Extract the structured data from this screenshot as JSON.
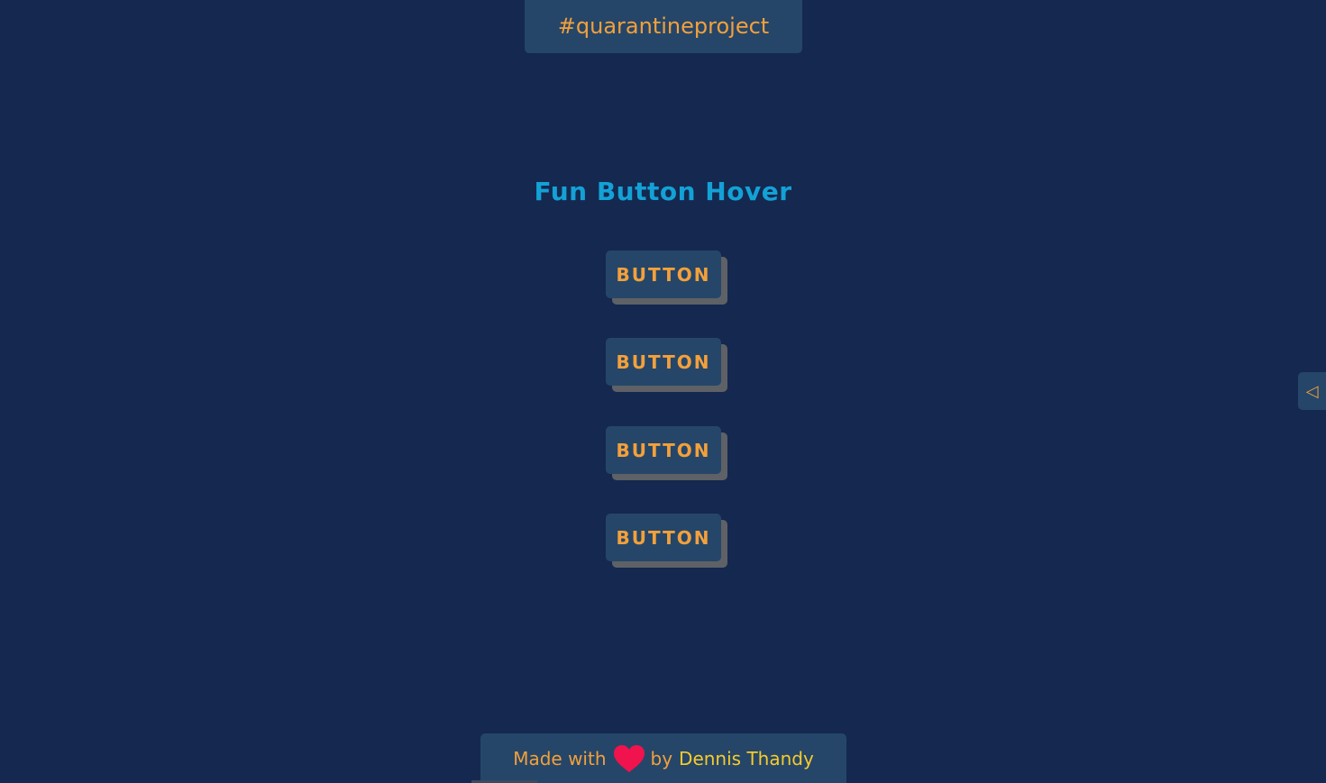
{
  "header": {
    "tag": "#quarantineproject"
  },
  "main": {
    "title": "Fun Button Hover",
    "buttons": [
      {
        "label": "Button"
      },
      {
        "label": "Button"
      },
      {
        "label": "Button"
      },
      {
        "label": "Button"
      }
    ]
  },
  "side_tab": {
    "icon": "triangle-left-icon",
    "glyph": "◁"
  },
  "footer": {
    "made_with": "Made with",
    "heart_icon": "heart-icon",
    "by": "by",
    "author": "Dennis Thandy"
  },
  "colors": {
    "background": "#15284f",
    "panel": "#254669",
    "accent_orange": "#f3a03b",
    "title_blue": "#13a1d6",
    "author_yellow": "#f7cb2a",
    "heart_red": "#f0134d",
    "button_shadow": "#5e6166"
  }
}
